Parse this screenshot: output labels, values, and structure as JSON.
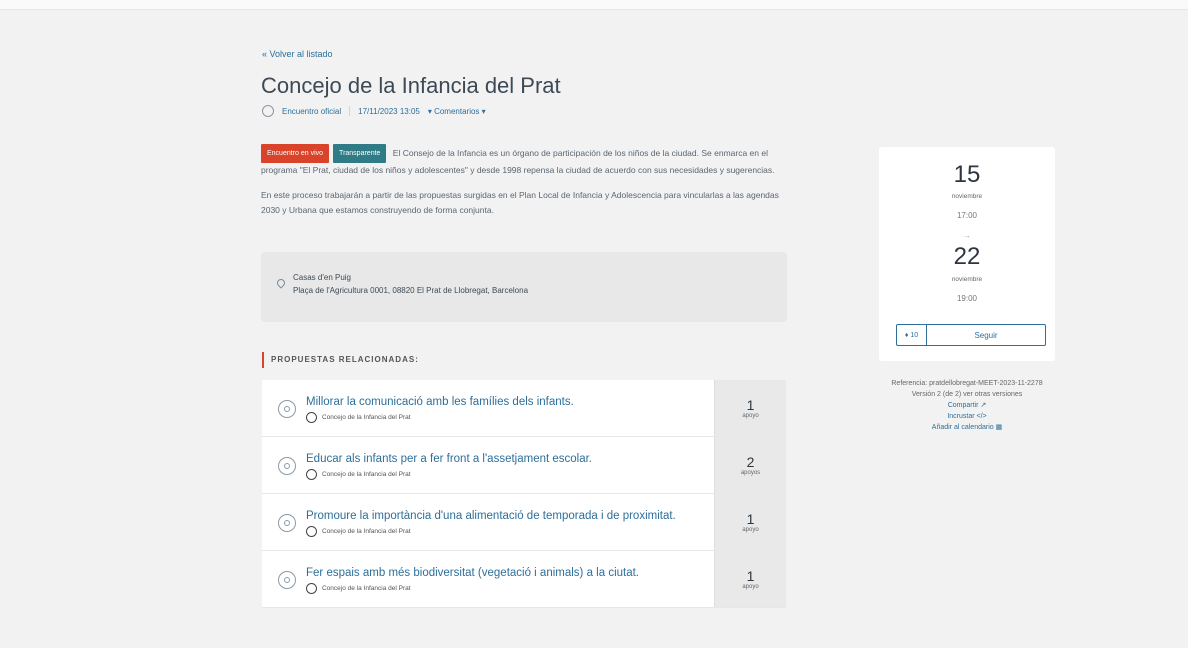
{
  "nav": {
    "back_link": "« Volver al listado"
  },
  "meeting": {
    "title": "Concejo de la Infancia del Prat",
    "author": "Encuentro oficial",
    "datetime": "17/11/2023 13:05",
    "comments_dropdown": "▾ Comentarios  ▾"
  },
  "badges": {
    "type": "Encuentro en vivo",
    "status": "Transparente"
  },
  "description": {
    "p1": "El Consejo de la Infancia es un órgano de participación de los niños de la ciudad. Se enmarca en el programa \"El Prat, ciudad de los niños y adolescentes\" y desde 1998 repensa la ciudad de acuerdo con sus necesidades y sugerencias.",
    "p2": "En este proceso trabajarán a partir de las propuestas surgidas en el Plan Local de Infancia y Adolescencia para vincularlas a las agendas 2030 y Urbana que estamos construyendo de forma conjunta."
  },
  "address": {
    "name": "Casas d'en Puig",
    "line": "Plaça de l'Agricultura 0001, 08820 El Prat de Llobregat, Barcelona"
  },
  "related": {
    "heading": "PROPUESTAS RELACIONADAS:",
    "items": [
      {
        "title": "Millorar la comunicació amb les famílies dels infants.",
        "author": "Concejo de la Infancia del Prat",
        "votes": "1",
        "votes_label": "apoyo"
      },
      {
        "title": "Educar als infants per a fer front a l'assetjament escolar.",
        "author": "Concejo de la Infancia del Prat",
        "votes": "2",
        "votes_label": "apoyos"
      },
      {
        "title": "Promoure la importància d'una alimentació de temporada i de proximitat.",
        "author": "Concejo de la Infancia del Prat",
        "votes": "1",
        "votes_label": "apoyo"
      },
      {
        "title": "Fer espais amb més biodiversitat (vegetació i animals) a la ciutat.",
        "author": "Concejo de la Infancia del Prat",
        "votes": "1",
        "votes_label": "apoyo"
      }
    ]
  },
  "dates": {
    "start_day": "15",
    "start_month": "noviembre",
    "start_time": "17:00",
    "arrow": "→",
    "end_day": "22",
    "end_month": "noviembre",
    "end_time": "19:00"
  },
  "follow": {
    "count": "♦ 10",
    "label": "Seguir"
  },
  "sidebar": {
    "reference": "Referencia: pratdellobregat-MEET-2023-11-2278",
    "version": "Versión 2 (de 2) ver otras versiones",
    "share": "Compartir ↗",
    "embed": "Incrustar </>",
    "calendar": "Añadir al calendario ▦"
  }
}
